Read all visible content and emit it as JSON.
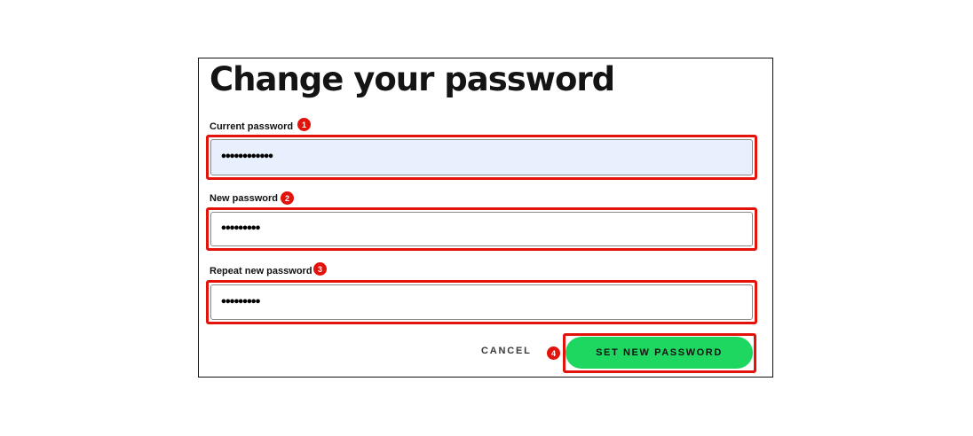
{
  "dialog": {
    "title": "Change your password",
    "fields": [
      {
        "label": "Current password",
        "value": "••••••••••••",
        "step": "1"
      },
      {
        "label": "New password",
        "value": "•••••••••",
        "step": "2"
      },
      {
        "label": "Repeat new password",
        "value": "•••••••••",
        "step": "3"
      }
    ],
    "actions": {
      "cancel_label": "CANCEL",
      "submit_label": "SET NEW PASSWORD",
      "submit_step": "4"
    }
  },
  "colors": {
    "annotation_red": "#e3120b",
    "primary_green": "#1ed760",
    "autofill_blue": "#e8f0fe"
  }
}
